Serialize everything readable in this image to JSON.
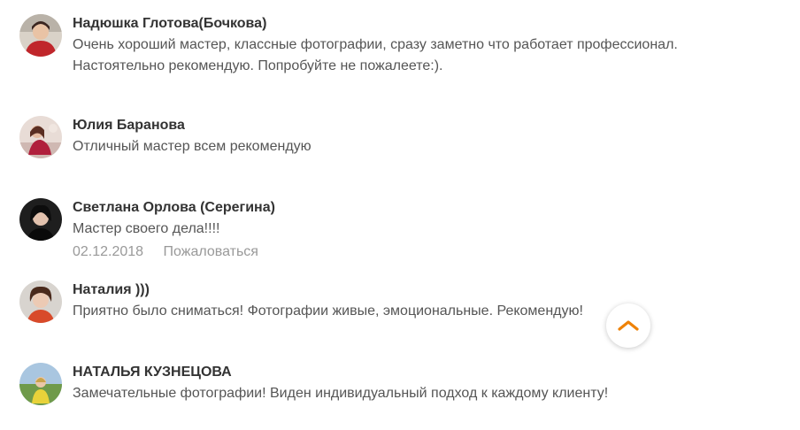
{
  "comments": [
    {
      "author": "Надюшка Глотова(Бочкова)",
      "text": "Очень хороший мастер, классные фотографии, сразу заметно что работает профессионал.\nНастоятельно рекомендую. Попробуйте не пожалеете:)."
    },
    {
      "author": "Юлия Баранова",
      "text": "Отличный мастер всем рекомендую"
    },
    {
      "author": "Светлана Орлова (Серегина)",
      "text": "Мастер своего дела!!!!",
      "date": "02.12.2018",
      "report": "Пожаловаться"
    },
    {
      "author": "Наталия )))",
      "text": "Приятно было сниматься! Фотографии живые, эмоциональные. Рекомендую!"
    },
    {
      "author": "НАТАЛЬЯ КУЗНЕЦОВА",
      "text": "Замечательные фотографии! Виден индивидуальный подход к каждому клиенту!"
    }
  ],
  "scroll_top": {
    "icon": "chevron-up-icon",
    "color": "#ee8208"
  },
  "colors": {
    "author": "#333333",
    "text": "#555555",
    "meta": "#999999",
    "accent": "#ee8208"
  }
}
